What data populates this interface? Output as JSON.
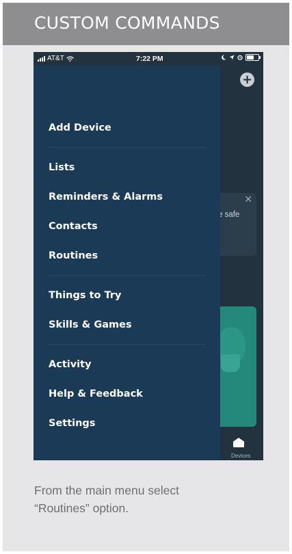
{
  "header": {
    "title": "CUSTOM COMMANDS"
  },
  "status_bar": {
    "carrier": "AT&T",
    "time": "7:22 PM"
  },
  "background_app": {
    "card_text": "e safe",
    "close_glyph": "✕",
    "add_glyph": "+",
    "nav_devices_label": "Devices"
  },
  "menu": {
    "groups": [
      [
        "Add Device"
      ],
      [
        "Lists",
        "Reminders & Alarms",
        "Contacts",
        "Routines"
      ],
      [
        "Things to Try",
        "Skills & Games"
      ],
      [
        "Activity",
        "Help & Feedback",
        "Settings"
      ]
    ],
    "items": {
      "add_device": "Add Device",
      "lists": "Lists",
      "reminders": "Reminders & Alarms",
      "contacts": "Contacts",
      "routines": "Routines",
      "things_to_try": "Things to Try",
      "skills_games": "Skills & Games",
      "activity": "Activity",
      "help_feedback": "Help & Feedback",
      "settings": "Settings"
    }
  },
  "caption": {
    "line1": "From the main menu select",
    "line2": "“Routines” option."
  },
  "colors": {
    "header_bg": "#8e8e90",
    "card_bg": "#e6e6e8",
    "drawer_bg": "#1b3a56",
    "app_bg": "#22323f",
    "accent_green": "#23897a",
    "caption_text": "#6f6f72"
  },
  "icons": [
    "signal-bars-icon",
    "wifi-icon",
    "moon-icon",
    "location-arrow-icon",
    "alarm-icon",
    "battery-icon",
    "plus-circle-icon",
    "close-icon",
    "devices-home-icon"
  ]
}
